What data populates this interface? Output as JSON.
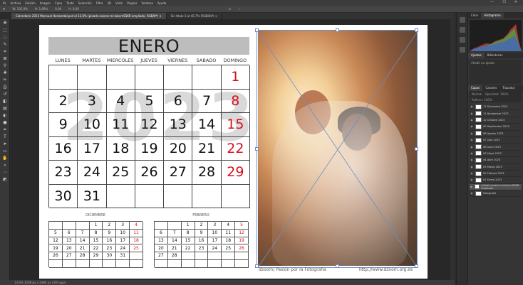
{
  "menu": [
    "Archivo",
    "Edición",
    "Imagen",
    "Capa",
    "Texto",
    "Selección",
    "Filtro",
    "3D",
    "Vista",
    "Plugins",
    "Ventana",
    "Ayuda"
  ],
  "window_controls": [
    "—",
    "☐",
    "✕"
  ],
  "options_bar": [
    "W: 105,9%",
    "H: 1,69%",
    "0,00",
    "H: 0,00"
  ],
  "tabs": [
    {
      "label": "Calendario 2023 Mensual Horizontal.psd al 13,6% (pleads-cosens-mi.tw\\cmSSKR-ampliado, RGB/8*) ×",
      "active": true
    },
    {
      "label": "Sin título-1 al 45,7% (RGB/8#) ×",
      "active": false
    }
  ],
  "calendar": {
    "month": "ENERO",
    "year": "2023",
    "weekdays": [
      "LUNES",
      "MARTES",
      "MIERCOLES",
      "JUEVES",
      "VIERNES",
      "SABADO",
      "DOMINGO"
    ],
    "weeks": [
      [
        "",
        "",
        "",
        "",
        "",
        "",
        "1"
      ],
      [
        "2",
        "3",
        "4",
        "5",
        "6",
        "7",
        "8"
      ],
      [
        "9",
        "10",
        "11",
        "12",
        "13",
        "14",
        "15"
      ],
      [
        "16",
        "17",
        "18",
        "19",
        "20",
        "21",
        "22"
      ],
      [
        "23",
        "24",
        "25",
        "26",
        "27",
        "28",
        "29"
      ],
      [
        "30",
        "31",
        "",
        "",
        "",
        "",
        ""
      ]
    ],
    "sunday_color": "#d4101c"
  },
  "mini_calendars": [
    {
      "title": "DICIEMBRE",
      "weeks": [
        [
          "",
          "",
          "",
          "1",
          "2",
          "3",
          "4"
        ],
        [
          "5",
          "6",
          "7",
          "8",
          "9",
          "10",
          "11"
        ],
        [
          "12",
          "13",
          "14",
          "15",
          "16",
          "17",
          "18"
        ],
        [
          "19",
          "20",
          "21",
          "22",
          "23",
          "24",
          "25"
        ],
        [
          "26",
          "27",
          "28",
          "29",
          "30",
          "31",
          ""
        ],
        [
          "",
          "",
          "",
          "",
          "",
          "",
          ""
        ]
      ]
    },
    {
      "title": "FEBRERO",
      "weeks": [
        [
          "",
          "",
          "1",
          "2",
          "3",
          "4",
          "5"
        ],
        [
          "6",
          "7",
          "8",
          "9",
          "10",
          "11",
          "12"
        ],
        [
          "13",
          "14",
          "15",
          "16",
          "17",
          "18",
          "19"
        ],
        [
          "20",
          "21",
          "22",
          "23",
          "24",
          "25",
          "26"
        ],
        [
          "27",
          "28",
          "",
          "",
          "",
          "",
          ""
        ],
        [
          "",
          "",
          "",
          "",
          "",
          "",
          ""
        ]
      ]
    }
  ],
  "credits": {
    "left": "dzoom| Pasión por la Fotografía",
    "right": "http://www.dzoom.org.es"
  },
  "status": "13,6%   3508 px x 2480 px (300 ppp)",
  "panel": {
    "top_tabs": [
      "Color",
      "Histograma"
    ],
    "adj_tabs": [
      "Ajustes",
      "Bibliotecas"
    ],
    "adj_text": "Añadir un ajuste",
    "layer_tabs": [
      "Capas",
      "Canales",
      "Trazados"
    ],
    "blend": "Normal",
    "opacity": "Opacidad: 100%",
    "fill": "Relleno: 100%",
    "layers": [
      {
        "name": "12 Diciembre 2023",
        "selected": false
      },
      {
        "name": "11 Noviembre 2023",
        "selected": false
      },
      {
        "name": "10 Octubre 2023",
        "selected": false
      },
      {
        "name": "09 Septiembre 2023",
        "selected": false
      },
      {
        "name": "08 Agosto 2023",
        "selected": false
      },
      {
        "name": "07 Julio 2023",
        "selected": false
      },
      {
        "name": "06 Junio 2023",
        "selected": false
      },
      {
        "name": "05 Mayo 2023",
        "selected": false
      },
      {
        "name": "04 Abril 2023",
        "selected": false
      },
      {
        "name": "03 Marzo 2023",
        "selected": false
      },
      {
        "name": "02 Febrero 2023",
        "selected": false
      },
      {
        "name": "01 Enero 2023",
        "selected": false
      },
      {
        "name": "pleads-cosens-mi.tw\\cmSSKR-ampliado",
        "selected": true
      },
      {
        "name": "Fotografía",
        "selected": false
      }
    ]
  }
}
